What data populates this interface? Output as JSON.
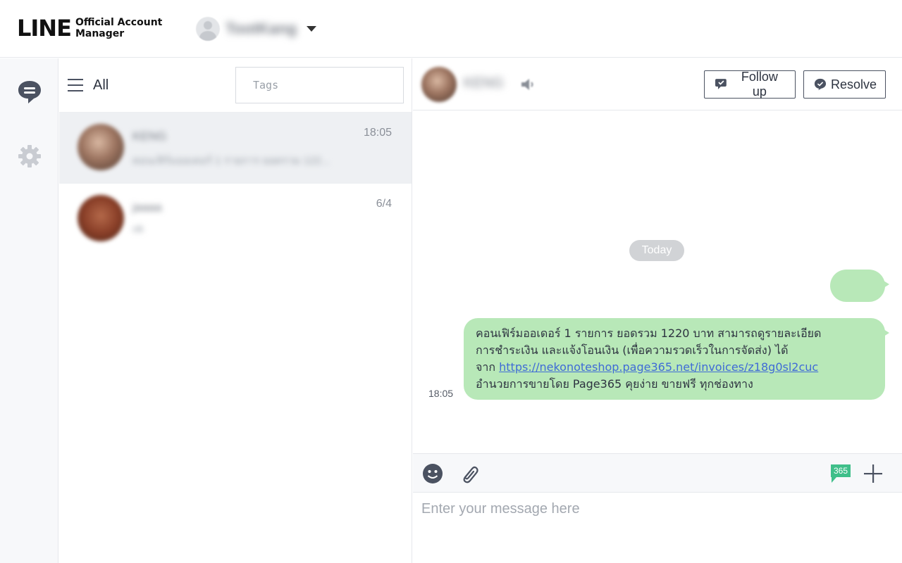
{
  "header": {
    "logo_main": "LINE",
    "logo_sub_line1": "Official Account",
    "logo_sub_line2": "Manager",
    "account_name": "TootKang"
  },
  "rail": {
    "items": [
      {
        "icon": "chat-icon",
        "active": true
      },
      {
        "icon": "gear-icon",
        "active": false
      }
    ]
  },
  "chat_list": {
    "filter_label": "All",
    "tags_placeholder": "Tags",
    "items": [
      {
        "name": "KENG",
        "preview": "คอนเฟิร์มออเดอร์ 1 รายการ ยอดรวม 122...",
        "time": "18:05",
        "active": true
      },
      {
        "name": "jaaaa",
        "preview": "ok",
        "time": "6/4",
        "active": false
      }
    ]
  },
  "conversation": {
    "contact_name": "KENG",
    "follow_up_label": "Follow up",
    "resolve_label": "Resolve",
    "date_separator": "Today",
    "message": {
      "line1": "คอนเฟิร์มออเดอร์ 1 รายการ ยอดรวม 1220 บาท สามารถดูรายละเอียด",
      "line2": "การชำระเงิน และแจ้งโอนเงิน (เพื่อความรวดเร็วในการจัดส่ง) ได้",
      "line3_prefix": "จาก ",
      "link": "https://nekonoteshop.page365.net/invoices/z18g0sl2cuc",
      "line4": "อำนวยการขายโดย Page365 คุยง่าย ขายฟรี ทุกช่องทาง",
      "time": "18:05"
    },
    "composer": {
      "placeholder": "Enter your message here",
      "page365_badge": "365"
    }
  },
  "colors": {
    "bubble": "#b8e8b8",
    "link": "#3f6bd6",
    "icon_dark": "#4b5261",
    "page365_green": "#3fbf8a"
  }
}
